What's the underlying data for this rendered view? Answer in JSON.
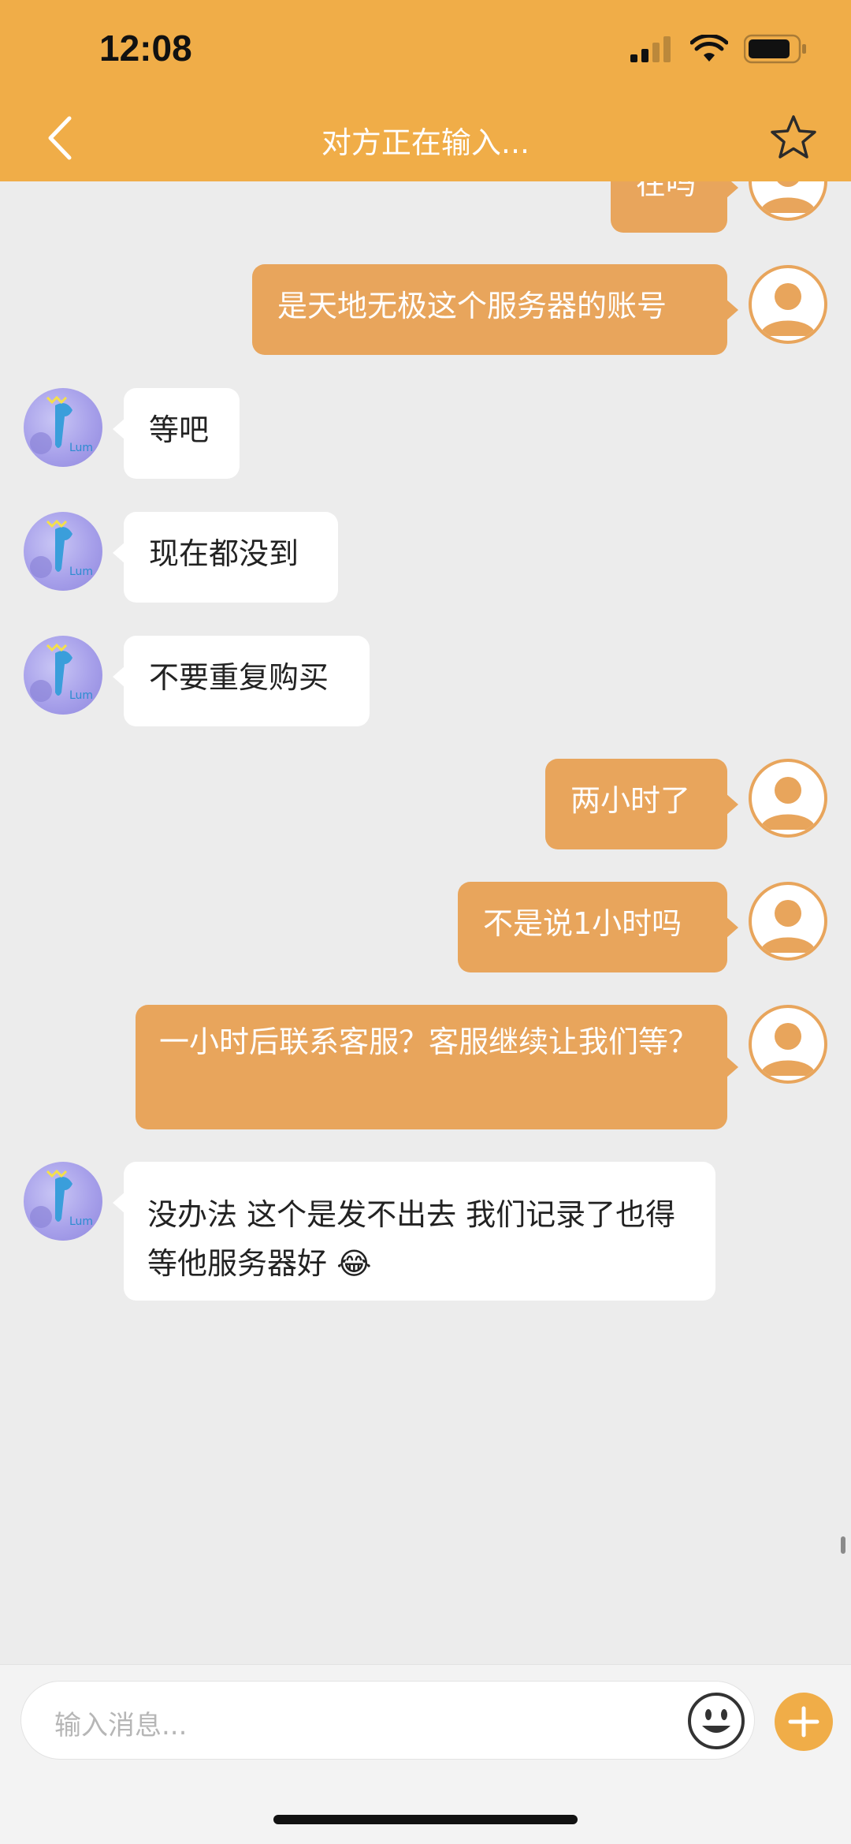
{
  "status_bar": {
    "time": "12:08"
  },
  "nav": {
    "title": "对方正在输入..."
  },
  "messages": [
    {
      "side": "out",
      "text": "在吗"
    },
    {
      "side": "out",
      "text": "是天地无极这个服务器的账号"
    },
    {
      "side": "in",
      "text": "等吧"
    },
    {
      "side": "in",
      "text": "现在都没到"
    },
    {
      "side": "in",
      "text": "不要重复购买"
    },
    {
      "side": "out",
      "text": "两小时了"
    },
    {
      "side": "out",
      "text": "不是说1小时吗"
    },
    {
      "side": "out",
      "text": "一小时后联系客服？客服继续让我们等？"
    },
    {
      "side": "in",
      "text": "没办法 这个是发不出去 我们记录了也得等他服务器好 😂"
    }
  ],
  "composer": {
    "placeholder": "输入消息..."
  },
  "colors": {
    "header": "#f0ad48",
    "outgoing_bubble": "#e8a55c",
    "incoming_bubble": "#ffffff",
    "background": "#ececec"
  },
  "icons": [
    "back-icon",
    "star-icon",
    "emoji-icon",
    "plus-icon",
    "signal-icon",
    "wifi-icon",
    "battery-icon"
  ]
}
